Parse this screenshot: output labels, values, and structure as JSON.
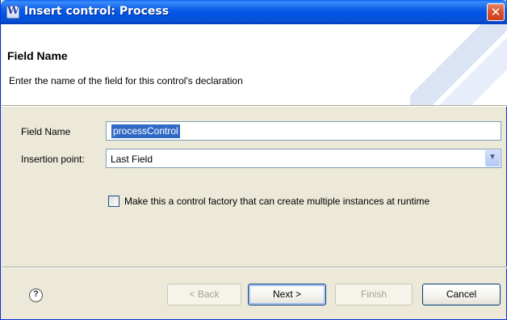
{
  "window": {
    "title": "Insert control: Process",
    "app_icon": "W",
    "close_glyph": "✕"
  },
  "header": {
    "title": "Field Name",
    "description": "Enter the name of the field for this control's declaration"
  },
  "form": {
    "field_name_label": "Field Name",
    "field_name_value": "processControl",
    "insertion_point_label": "Insertion point:",
    "insertion_point_value": "Last Field",
    "factory_checkbox_label": "Make this a control factory that can create multiple instances at runtime",
    "factory_checked": false
  },
  "footer": {
    "help_glyph": "?",
    "back_label": "< Back",
    "next_label": "Next >",
    "finish_label": "Finish",
    "cancel_label": "Cancel"
  },
  "icons": {
    "dropdown": "chevron-down-icon",
    "help": "help-icon",
    "close": "close-icon"
  },
  "colors": {
    "titlebar": "#0054e3",
    "selection": "#316ac5",
    "dialog_bg": "#ece9d8"
  }
}
